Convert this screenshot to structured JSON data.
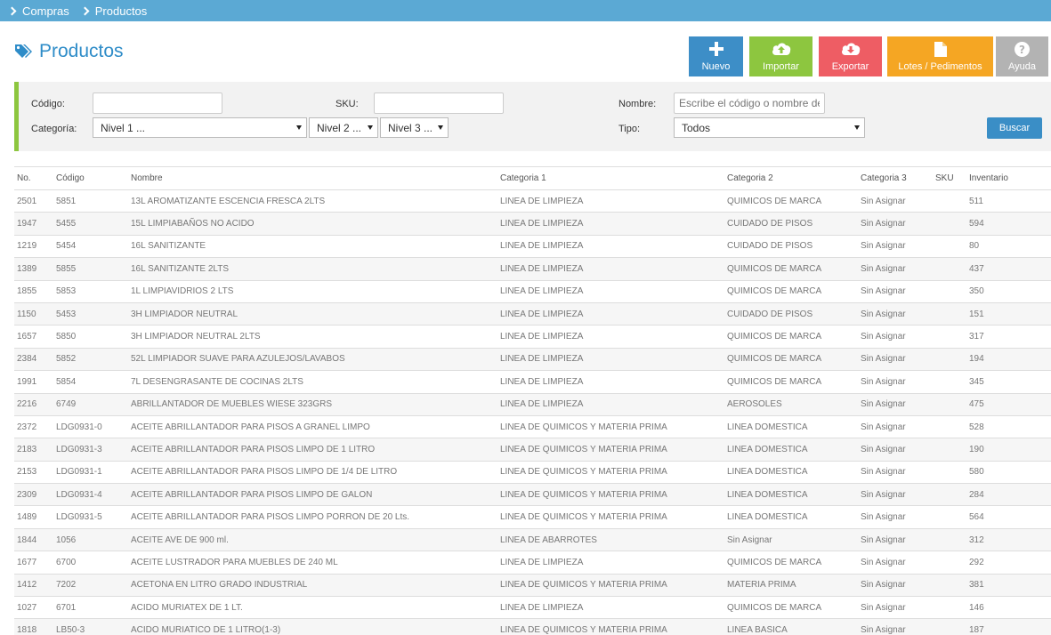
{
  "breadcrumb": {
    "items": [
      "Compras",
      "Productos"
    ]
  },
  "page": {
    "title": "Productos"
  },
  "actions": [
    {
      "label": "Nuevo",
      "icon": "plus-icon",
      "color": "#3d8ec7"
    },
    {
      "label": "Importar",
      "icon": "cloud-upload-icon",
      "color": "#8dc63f"
    },
    {
      "label": "Exportar",
      "icon": "cloud-download-icon",
      "color": "#ee5d64"
    },
    {
      "label": "Lotes / Pedimentos",
      "icon": "file-icon",
      "color": "#f5a623"
    },
    {
      "label": "Ayuda",
      "icon": "question-circle-icon",
      "color": "#b3b3b3"
    }
  ],
  "filters": {
    "codigo_label": "Código:",
    "codigo_value": "",
    "sku_label": "SKU:",
    "sku_value": "",
    "nombre_label": "Nombre:",
    "nombre_placeholder": "Escribe el código o nombre del",
    "categoria_label": "Categoría:",
    "nivel1": "Nivel 1 ...",
    "nivel2": "Nivel 2 ...",
    "nivel3": "Nivel 3 ...",
    "tipo_label": "Tipo:",
    "tipo_value": "Todos",
    "buscar_label": "Buscar"
  },
  "table": {
    "columns": [
      "No.",
      "Código",
      "Nombre",
      "Categoria 1",
      "Categoria 2",
      "Categoria 3",
      "SKU",
      "Inventario"
    ],
    "rows": [
      [
        "2501",
        "5851",
        "13L AROMATIZANTE ESCENCIA FRESCA 2LTS",
        "LINEA DE LIMPIEZA",
        "QUIMICOS DE MARCA",
        "Sin Asignar",
        "",
        "511"
      ],
      [
        "1947",
        "5455",
        "15L LIMPIABAÑOS NO ACIDO",
        "LINEA DE LIMPIEZA",
        "CUIDADO DE PISOS",
        "Sin Asignar",
        "",
        "594"
      ],
      [
        "1219",
        "5454",
        "16L SANITIZANTE",
        "LINEA DE LIMPIEZA",
        "CUIDADO DE PISOS",
        "Sin Asignar",
        "",
        "80"
      ],
      [
        "1389",
        "5855",
        "16L SANITIZANTE 2LTS",
        "LINEA DE LIMPIEZA",
        "QUIMICOS DE MARCA",
        "Sin Asignar",
        "",
        "437"
      ],
      [
        "1855",
        "5853",
        "1L LIMPIAVIDRIOS 2 LTS",
        "LINEA DE LIMPIEZA",
        "QUIMICOS DE MARCA",
        "Sin Asignar",
        "",
        "350"
      ],
      [
        "1150",
        "5453",
        "3H LIMPIADOR NEUTRAL",
        "LINEA DE LIMPIEZA",
        "CUIDADO DE PISOS",
        "Sin Asignar",
        "",
        "151"
      ],
      [
        "1657",
        "5850",
        "3H LIMPIADOR NEUTRAL 2LTS",
        "LINEA DE LIMPIEZA",
        "QUIMICOS DE MARCA",
        "Sin Asignar",
        "",
        "317"
      ],
      [
        "2384",
        "5852",
        "52L LIMPIADOR SUAVE PARA AZULEJOS/LAVABOS",
        "LINEA DE LIMPIEZA",
        "QUIMICOS DE MARCA",
        "Sin Asignar",
        "",
        "194"
      ],
      [
        "1991",
        "5854",
        "7L DESENGRASANTE DE COCINAS 2LTS",
        "LINEA DE LIMPIEZA",
        "QUIMICOS DE MARCA",
        "Sin Asignar",
        "",
        "345"
      ],
      [
        "2216",
        "6749",
        "ABRILLANTADOR DE MUEBLES WIESE 323GRS",
        "LINEA DE LIMPIEZA",
        "AEROSOLES",
        "Sin Asignar",
        "",
        "475"
      ],
      [
        "2372",
        "LDG0931-0",
        "ACEITE ABRILLANTADOR PARA PISOS A GRANEL LIMPO",
        "LINEA DE QUIMICOS Y MATERIA PRIMA",
        "LINEA DOMESTICA",
        "Sin Asignar",
        "",
        "528"
      ],
      [
        "2183",
        "LDG0931-3",
        "ACEITE ABRILLANTADOR PARA PISOS LIMPO DE 1 LITRO",
        "LINEA DE QUIMICOS Y MATERIA PRIMA",
        "LINEA DOMESTICA",
        "Sin Asignar",
        "",
        "190"
      ],
      [
        "2153",
        "LDG0931-1",
        "ACEITE ABRILLANTADOR PARA PISOS LIMPO DE 1/4 DE LITRO",
        "LINEA DE QUIMICOS Y MATERIA PRIMA",
        "LINEA DOMESTICA",
        "Sin Asignar",
        "",
        "580"
      ],
      [
        "2309",
        "LDG0931-4",
        "ACEITE ABRILLANTADOR PARA PISOS LIMPO DE GALON",
        "LINEA DE QUIMICOS Y MATERIA PRIMA",
        "LINEA DOMESTICA",
        "Sin Asignar",
        "",
        "284"
      ],
      [
        "1489",
        "LDG0931-5",
        "ACEITE ABRILLANTADOR PARA PISOS LIMPO PORRON DE 20 Lts.",
        "LINEA DE QUIMICOS Y MATERIA PRIMA",
        "LINEA DOMESTICA",
        "Sin Asignar",
        "",
        "564"
      ],
      [
        "1844",
        "1056",
        "ACEITE AVE DE 900 ml.",
        "LINEA DE ABARROTES",
        "Sin Asignar",
        "Sin Asignar",
        "",
        "312"
      ],
      [
        "1677",
        "6700",
        "ACEITE LUSTRADOR PARA MUEBLES DE 240 ML",
        "LINEA DE LIMPIEZA",
        "QUIMICOS DE MARCA",
        "Sin Asignar",
        "",
        "292"
      ],
      [
        "1412",
        "7202",
        "ACETONA EN LITRO GRADO INDUSTRIAL",
        "LINEA DE QUIMICOS Y MATERIA PRIMA",
        "MATERIA PRIMA",
        "Sin Asignar",
        "",
        "381"
      ],
      [
        "1027",
        "6701",
        "ACIDO MURIATEX DE 1 LT.",
        "LINEA DE LIMPIEZA",
        "QUIMICOS DE MARCA",
        "Sin Asignar",
        "",
        "146"
      ],
      [
        "1818",
        "LB50-3",
        "ACIDO MURIATICO DE 1 LITRO(1-3)",
        "LINEA DE QUIMICOS Y MATERIA PRIMA",
        "LINEA BASICA",
        "Sin Asignar",
        "",
        "187"
      ]
    ]
  }
}
